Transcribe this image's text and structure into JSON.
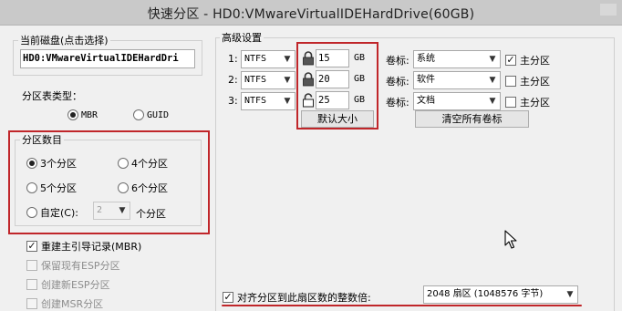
{
  "window": {
    "title": "快速分区 - HD0:VMwareVirtualIDEHardDrive(60GB)"
  },
  "left": {
    "current_disk_label": "当前磁盘(点击选择)",
    "current_disk_value": "HD0:VMwareVirtualIDEHardDri",
    "partition_table_label": "分区表类型：",
    "table_types": [
      {
        "label": "MBR",
        "selected": true
      },
      {
        "label": "GUID",
        "selected": false
      }
    ],
    "partition_count_label": "分区数目",
    "counts": [
      {
        "label": "3个分区",
        "selected": true
      },
      {
        "label": "4个分区",
        "selected": false
      },
      {
        "label": "5个分区",
        "selected": false
      },
      {
        "label": "6个分区",
        "selected": false
      }
    ],
    "custom_label": "自定(C):",
    "custom_value": "2",
    "custom_suffix": "个分区",
    "options": [
      {
        "label": "重建主引导记录(MBR)",
        "checked": true,
        "enabled": true
      },
      {
        "label": "保留现有ESP分区",
        "checked": false,
        "enabled": false
      },
      {
        "label": "创建新ESP分区",
        "checked": false,
        "enabled": false
      },
      {
        "label": "创建MSR分区",
        "checked": false,
        "enabled": false
      }
    ]
  },
  "advanced": {
    "label": "高级设置",
    "rows": [
      {
        "num": "1:",
        "fs": "NTFS",
        "size": "15",
        "unit": "GB",
        "locked": true,
        "vol_label": "卷标:",
        "vol": "系统",
        "primary_label": "主分区",
        "primary": true
      },
      {
        "num": "2:",
        "fs": "NTFS",
        "size": "20",
        "unit": "GB",
        "locked": true,
        "vol_label": "卷标:",
        "vol": "软件",
        "primary_label": "主分区",
        "primary": false
      },
      {
        "num": "3:",
        "fs": "NTFS",
        "size": "25",
        "unit": "GB",
        "locked": false,
        "vol_label": "卷标:",
        "vol": "文档",
        "primary_label": "主分区",
        "primary": false
      }
    ],
    "default_size_button": "默认大小",
    "clear_labels_button": "清空所有卷标"
  },
  "align": {
    "label": "对齐分区到此扇区数的整数倍:",
    "checked": true,
    "value": "2048 扇区 (1048576 字节)"
  },
  "colors": {
    "highlight": "#c0262a",
    "titlebar": "#c9c9c9",
    "background": "#f0f0f0"
  }
}
